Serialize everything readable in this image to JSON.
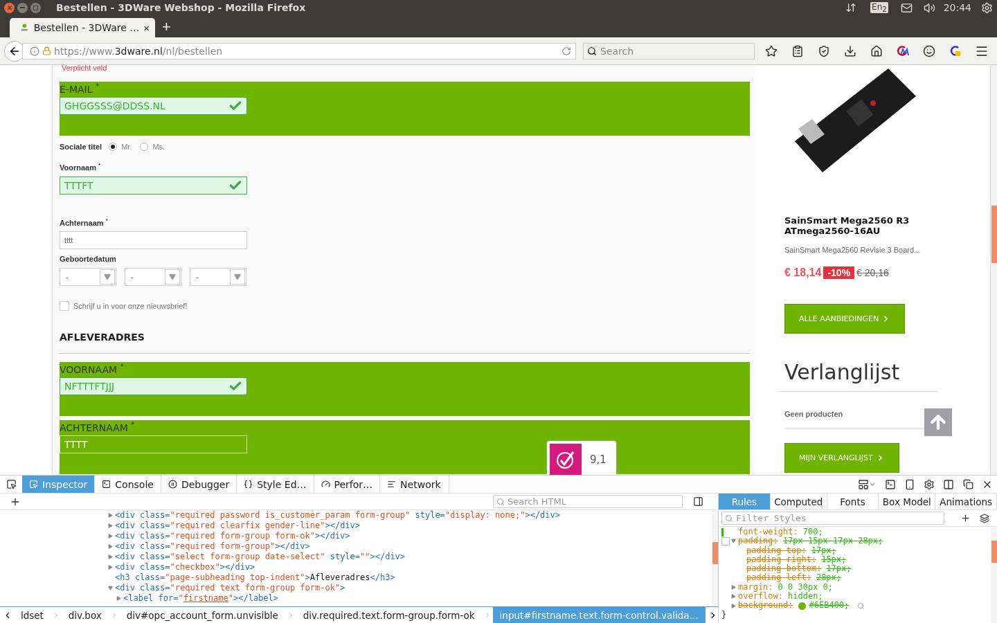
{
  "os_bar": {
    "title": "Bestellen - 3DWare Webshop - Mozilla Firefox",
    "keyboard": "En$_{2}$",
    "time": "20:44"
  },
  "tab": {
    "title": "Bestellen - 3DWare …",
    "close": "×",
    "new_tab": "+"
  },
  "nav": {
    "url": {
      "scheme": "https://www.",
      "domain": "3dware.nl",
      "path": "/nl/bestellen"
    },
    "search_placeholder": "Search"
  },
  "form": {
    "error": "Verplicht veld",
    "items": [
      {
        "kind": "highlight",
        "label": "E-MAIL $^{*}$",
        "value": "GHGGSSS@DDSS.NL",
        "valid": true
      },
      {
        "kind": "radio",
        "label": "Sociale titel",
        "options": [
          {
            "label": "Mr.",
            "selected": true
          },
          {
            "label": "Ms.",
            "selected": false
          }
        ]
      },
      {
        "kind": "text",
        "label": "Voornaam $^{*}$",
        "value": "TTTFT",
        "valid": true
      },
      {
        "kind": "text",
        "label": "Achternaam $^{*}$",
        "value": "tttt",
        "valid": false
      },
      {
        "kind": "date",
        "label": "Geboortedatum",
        "selects": [
          "-",
          "-",
          "-"
        ]
      },
      {
        "kind": "checkbox",
        "label": "Schrijf u in voor onze nieuwsbrief!",
        "checked": false
      },
      {
        "kind": "heading",
        "label": "AFLEVERADRES"
      },
      {
        "kind": "highlight",
        "label": "VOORNAAM $^{*}$",
        "value": "NFTTTFTJJJ",
        "valid": true
      },
      {
        "kind": "highlight",
        "label": "ACHTERNAAM $^{*}$",
        "value": "TTTT",
        "valid": false
      }
    ]
  },
  "rating": {
    "score": "9,1"
  },
  "sidebar": {
    "product": {
      "title": "SainSmart Mega2560 R3 ATmega2560-16AU",
      "description": "SainSmart Mega2560 Revisie 3 Board...",
      "price": "€ 18,14",
      "discount": "-10%",
      "old_price": "€ 20,16"
    },
    "offers_button": "ALLE AANBIEDINGEN",
    "wishlist": {
      "title": "Verlanglijst",
      "empty": "Geen producten",
      "button": "MIJN VERLANGLIJST"
    }
  },
  "devtools": {
    "tabs": [
      {
        "label": "Inspector",
        "selected": true
      },
      {
        "label": "Console",
        "selected": false
      },
      {
        "label": "Debugger",
        "selected": false
      },
      {
        "label": "Style Ed…",
        "selected": false
      },
      {
        "label": "Perfor…",
        "selected": false
      },
      {
        "label": "Network",
        "selected": false
      }
    ],
    "search_placeholder": "Search HTML",
    "markup": [
      {
        "expanded": false,
        "segments": [
          {
            "kind": "tag",
            "text": "<div class="
          },
          {
            "kind": "value",
            "text": "\"required password is_customer_param form-group\""
          },
          {
            "kind": "tag",
            "text": " style="
          },
          {
            "kind": "value",
            "text": "\"display: none;\""
          },
          {
            "kind": "tag",
            "text": "></div>"
          }
        ]
      },
      {
        "expanded": false,
        "segments": [
          {
            "kind": "tag",
            "text": "<div class="
          },
          {
            "kind": "value",
            "text": "\"required clearfix gender-line\""
          },
          {
            "kind": "tag",
            "text": "></div>"
          }
        ]
      },
      {
        "expanded": false,
        "segments": [
          {
            "kind": "tag",
            "text": "<div class="
          },
          {
            "kind": "value",
            "text": "\"required form-group form-ok\""
          },
          {
            "kind": "tag",
            "text": "></div>"
          }
        ]
      },
      {
        "expanded": false,
        "segments": [
          {
            "kind": "tag",
            "text": "<div class="
          },
          {
            "kind": "value",
            "text": "\"required form-group\""
          },
          {
            "kind": "tag",
            "text": "></div>"
          }
        ]
      },
      {
        "expanded": false,
        "segments": [
          {
            "kind": "tag",
            "text": "<div class="
          },
          {
            "kind": "value",
            "text": "\"select form-group date-select\""
          },
          {
            "kind": "tag",
            "text": " style="
          },
          {
            "kind": "value",
            "text": "\"\""
          },
          {
            "kind": "tag",
            "text": "></div>"
          }
        ]
      },
      {
        "expanded": false,
        "segments": [
          {
            "kind": "tag",
            "text": "<div class="
          },
          {
            "kind": "value",
            "text": "\"checkbox\""
          },
          {
            "kind": "tag",
            "text": "></div>"
          }
        ]
      },
      {
        "segments": [
          {
            "kind": "tag",
            "text": "<h3 class="
          },
          {
            "kind": "value",
            "text": "\"page-subheading top-indent\""
          },
          {
            "kind": "tag",
            "text": ">"
          },
          {
            "kind": "text",
            "text": "Afleveradres"
          },
          {
            "kind": "tag",
            "text": "</h3>"
          }
        ]
      },
      {
        "expanded": true,
        "segments": [
          {
            "kind": "tag",
            "text": "<div class="
          },
          {
            "kind": "value",
            "text": "\"required text form-group form-ok\""
          },
          {
            "kind": "tag",
            "text": ">"
          }
        ],
        "children": [
          {
            "expanded": false,
            "segments": [
              {
                "kind": "tag",
                "text": "<label for="
              },
              {
                "kind": "value",
                "text": "\""
              },
              {
                "kind": "link",
                "text": "firstname"
              },
              {
                "kind": "value",
                "text": "\""
              },
              {
                "kind": "tag",
                "text": "></label>"
              }
            ]
          }
        ]
      }
    ],
    "breadcrumbs": [
      {
        "label": "ldset",
        "selected": false
      },
      {
        "label": "div.box",
        "selected": false
      },
      {
        "label": "div#opc_account_form.unvisible",
        "selected": false
      },
      {
        "label": "div.required.text.form-group.form-ok",
        "selected": false
      },
      {
        "label": "input#firstname.text.form-control.valida…",
        "selected": true
      }
    ],
    "sidebar_tabs": [
      {
        "label": "Rules",
        "selected": true
      },
      {
        "label": "Computed",
        "selected": false
      },
      {
        "label": "Fonts",
        "selected": false
      },
      {
        "label": "Box Model",
        "selected": false
      },
      {
        "label": "Animations",
        "selected": false
      }
    ],
    "filter_placeholder": "Filter Styles",
    "rules": [
      {
        "property": "font-weight:",
        "value": "700;",
        "overridden": false,
        "changed": true
      },
      {
        "property": "padding:",
        "value": "17px 15px 17px 28px;",
        "overridden": true,
        "changed": false,
        "checked": false,
        "expanded": true,
        "children": [
          {
            "property": "padding-top:",
            "value": "17px;",
            "overridden": true
          },
          {
            "property": "padding-right:",
            "value": "15px;",
            "overridden": true
          },
          {
            "property": "padding-bottom:",
            "value": "17px;",
            "overridden": true
          },
          {
            "property": "padding-left:",
            "value": "28px;",
            "overridden": true
          }
        ]
      },
      {
        "property": "margin:",
        "value": "0 0 30px 0;",
        "overridden": false,
        "changed": false,
        "expanded": false
      },
      {
        "property": "overflow:",
        "value": "hidden;",
        "overridden": false,
        "changed": false,
        "expanded": false
      },
      {
        "property": "background:",
        "value": "#6EB400;",
        "overridden": true,
        "changed": false,
        "expanded": false,
        "color": "#6eb400"
      }
    ],
    "closing": "}"
  }
}
